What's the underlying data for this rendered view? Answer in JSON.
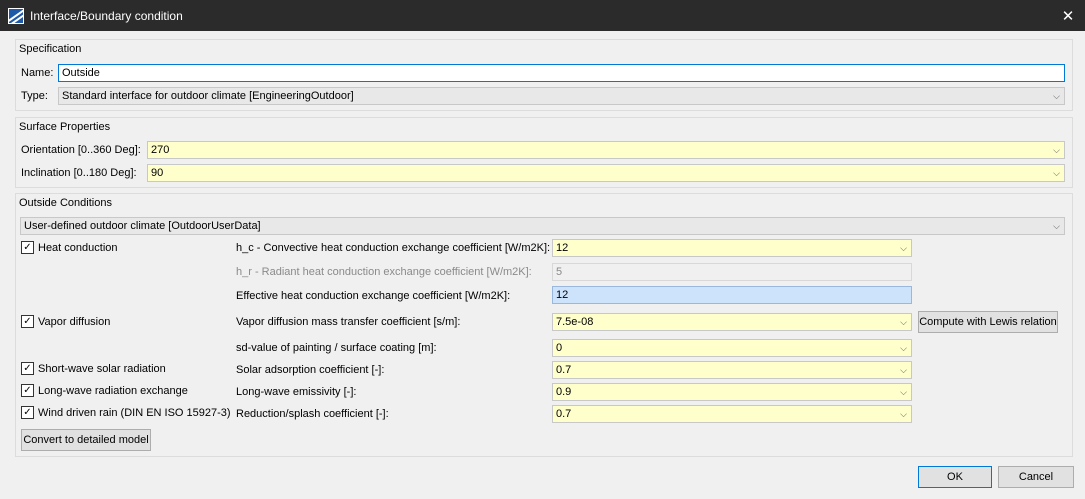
{
  "window": {
    "title": "Interface/Boundary condition",
    "icon": "app-logo-icon",
    "close_glyph": "✕"
  },
  "specification": {
    "title": "Specification",
    "name_label": "Name:",
    "name_value": "Outside",
    "type_label": "Type:",
    "type_value": "Standard interface for outdoor climate [EngineeringOutdoor]"
  },
  "surface": {
    "title": "Surface Properties",
    "orientation_label": "Orientation [0..360 Deg]:",
    "orientation_value": "270",
    "inclination_label": "Inclination [0..180 Deg]:",
    "inclination_value": "90"
  },
  "outside": {
    "title": "Outside Conditions",
    "climate_value": "User-defined outdoor climate [OutdoorUserData]",
    "checks": {
      "heat": "Heat conduction",
      "vapor": "Vapor diffusion",
      "shortwave": "Short-wave solar radiation",
      "longwave": "Long-wave radiation exchange",
      "rain": "Wind driven rain (DIN EN ISO 15927-3)"
    },
    "params": {
      "hc_label": "h_c - Convective heat conduction exchange coefficient [W/m2K]:",
      "hc_value": "12",
      "hr_label": "h_r - Radiant heat conduction exchange coefficient [W/m2K]:",
      "hr_value": "5",
      "eff_label": "Effective heat conduction exchange coefficient [W/m2K]:",
      "eff_value": "12",
      "vapor_label": "Vapor diffusion mass transfer coefficient [s/m]:",
      "vapor_value": "7.5e-08",
      "sd_label": "sd-value of painting / surface coating [m]:",
      "sd_value": "0",
      "solar_label": "Solar adsorption coefficient [-]:",
      "solar_value": "0.7",
      "emis_label": "Long-wave emissivity [-]:",
      "emis_value": "0.9",
      "splash_label": "Reduction/splash coefficient [-]:",
      "splash_value": "0.7"
    },
    "lewis_button": "Compute with Lewis relation",
    "convert_button": "Convert to detailed model"
  },
  "footer": {
    "ok": "OK",
    "cancel": "Cancel"
  },
  "glyphs": {
    "check": "✓",
    "chevron": "⌵"
  },
  "colors": {
    "field_yellow": "#ffffcc",
    "field_blue": "#cde3fb",
    "accent": "#0078d7",
    "titlebar": "#2b2b2b"
  }
}
